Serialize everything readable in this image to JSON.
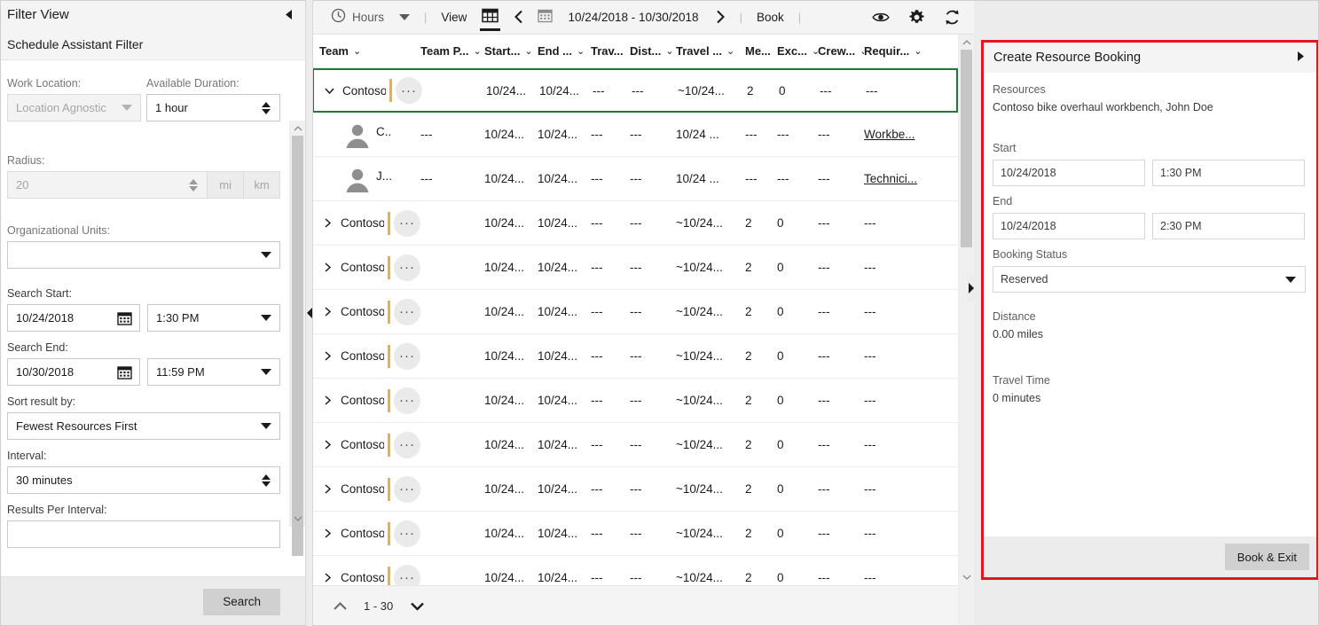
{
  "filter_panel": {
    "title": "Filter View",
    "subtitle": "Schedule Assistant Filter",
    "collapse_icon": "chevron-left-icon",
    "fields": {
      "work_location_label": "Work Location:",
      "work_location_value": "Location Agnostic",
      "available_duration_label": "Available Duration:",
      "available_duration_value": "1 hour",
      "radius_label": "Radius:",
      "radius_value": "20",
      "unit_mi": "mi",
      "unit_km": "km",
      "org_units_label": "Organizational Units:",
      "org_units_value": "",
      "search_start_label": "Search Start:",
      "search_start_date": "10/24/2018",
      "search_start_time": "1:30 PM",
      "search_end_label": "Search End:",
      "search_end_date": "10/30/2018",
      "search_end_time": "11:59 PM",
      "sort_label": "Sort result by:",
      "sort_value": "Fewest Resources First",
      "interval_label": "Interval:",
      "interval_value": "30 minutes",
      "results_per_interval_label": "Results Per Interval:",
      "results_per_interval_value": ""
    },
    "search_button": "Search"
  },
  "toolbar": {
    "hours_label": "Hours",
    "clock_icon": "clock-icon",
    "view_label": "View",
    "grid_icon": "grid-view-icon",
    "prev_icon": "chevron-left-icon",
    "calendar_icon": "calendar-icon",
    "date_range": "10/24/2018 - 10/30/2018",
    "next_icon": "chevron-right-icon",
    "book_label": "Book",
    "separator": "|",
    "eye_icon": "eye-icon",
    "gear_icon": "gear-icon",
    "refresh_icon": "refresh-icon"
  },
  "grid": {
    "columns": [
      "Team",
      "Team P...",
      "Start...",
      "End ...",
      "Trav...",
      "Dist...",
      "Travel ...",
      "Me...",
      "Exc...",
      "Crew...",
      "Requir..."
    ],
    "rows": [
      {
        "type": "group",
        "selected": true,
        "expanded": true,
        "team": "Contoso b...",
        "team_p": "",
        "start": "10/24...",
        "end": "10/24...",
        "travel": "---",
        "distance": "---",
        "travel_back": "~10/24...",
        "members": "2",
        "exceptions": "0",
        "crew": "---",
        "requirement": "---"
      },
      {
        "type": "member",
        "avatar": "person-avatar-icon",
        "team": "C..",
        "team_p": "---",
        "start": "10/24...",
        "end": "10/24...",
        "travel": "---",
        "distance": "---",
        "travel_back": "10/24 ...",
        "members": "---",
        "exceptions": "---",
        "crew": "---",
        "requirement": "Workbe..."
      },
      {
        "type": "member",
        "avatar": "person-avatar-icon",
        "team": "J...",
        "team_p": "---",
        "start": "10/24...",
        "end": "10/24...",
        "travel": "---",
        "distance": "---",
        "travel_back": "10/24 ...",
        "members": "---",
        "exceptions": "---",
        "crew": "---",
        "requirement": "Technici..."
      },
      {
        "type": "group",
        "selected": false,
        "expanded": false,
        "team": "Contoso bi...",
        "team_p": "",
        "start": "10/24...",
        "end": "10/24...",
        "travel": "---",
        "distance": "---",
        "travel_back": "~10/24...",
        "members": "2",
        "exceptions": "0",
        "crew": "---",
        "requirement": "---"
      },
      {
        "type": "group",
        "selected": false,
        "expanded": false,
        "team": "Contoso bi...",
        "team_p": "",
        "start": "10/24...",
        "end": "10/24...",
        "travel": "---",
        "distance": "---",
        "travel_back": "~10/24...",
        "members": "2",
        "exceptions": "0",
        "crew": "---",
        "requirement": "---"
      },
      {
        "type": "group",
        "selected": false,
        "expanded": false,
        "team": "Contoso bi...",
        "team_p": "",
        "start": "10/24...",
        "end": "10/24...",
        "travel": "---",
        "distance": "---",
        "travel_back": "~10/24...",
        "members": "2",
        "exceptions": "0",
        "crew": "---",
        "requirement": "---"
      },
      {
        "type": "group",
        "selected": false,
        "expanded": false,
        "team": "Contoso bi...",
        "team_p": "",
        "start": "10/24...",
        "end": "10/24...",
        "travel": "---",
        "distance": "---",
        "travel_back": "~10/24...",
        "members": "2",
        "exceptions": "0",
        "crew": "---",
        "requirement": "---"
      },
      {
        "type": "group",
        "selected": false,
        "expanded": false,
        "team": "Contoso bi...",
        "team_p": "",
        "start": "10/24...",
        "end": "10/24...",
        "travel": "---",
        "distance": "---",
        "travel_back": "~10/24...",
        "members": "2",
        "exceptions": "0",
        "crew": "---",
        "requirement": "---"
      },
      {
        "type": "group",
        "selected": false,
        "expanded": false,
        "team": "Contoso bi...",
        "team_p": "",
        "start": "10/24...",
        "end": "10/24...",
        "travel": "---",
        "distance": "---",
        "travel_back": "~10/24...",
        "members": "2",
        "exceptions": "0",
        "crew": "---",
        "requirement": "---"
      },
      {
        "type": "group",
        "selected": false,
        "expanded": false,
        "team": "Contoso bi...",
        "team_p": "",
        "start": "10/24...",
        "end": "10/24...",
        "travel": "---",
        "distance": "---",
        "travel_back": "~10/24...",
        "members": "2",
        "exceptions": "0",
        "crew": "---",
        "requirement": "---"
      },
      {
        "type": "group",
        "selected": false,
        "expanded": false,
        "team": "Contoso bi...",
        "team_p": "",
        "start": "10/24...",
        "end": "10/24...",
        "travel": "---",
        "distance": "---",
        "travel_back": "~10/24...",
        "members": "2",
        "exceptions": "0",
        "crew": "---",
        "requirement": "---"
      },
      {
        "type": "group",
        "selected": false,
        "expanded": false,
        "team": "Contoso bi...",
        "team_p": "",
        "start": "10/24...",
        "end": "10/24...",
        "travel": "---",
        "distance": "---",
        "travel_back": "~10/24...",
        "members": "2",
        "exceptions": "0",
        "crew": "---",
        "requirement": "---"
      }
    ],
    "pager": {
      "up_icon": "chevron-up-icon",
      "range": "1 - 30",
      "down_icon": "chevron-down-icon"
    }
  },
  "booking_panel": {
    "title": "Create Resource Booking",
    "expand_icon": "chevron-right-icon",
    "resources_label": "Resources",
    "resources_value": "Contoso bike overhaul workbench, John Doe",
    "start_label": "Start",
    "start_date": "10/24/2018",
    "start_time": "1:30 PM",
    "end_label": "End",
    "end_date": "10/24/2018",
    "end_time": "2:30 PM",
    "booking_status_label": "Booking Status",
    "booking_status_value": "Reserved",
    "distance_label": "Distance",
    "distance_value": "0.00 miles",
    "travel_time_label": "Travel Time",
    "travel_time_value": "0 minutes",
    "book_exit_button": "Book & Exit"
  },
  "colors": {
    "selection_green": "#217a36",
    "highlight_red": "#e8141c",
    "toolbar_bg": "#f4f4f4",
    "panel_bg": "#ececec",
    "accent_amber": "#e8b33c"
  }
}
